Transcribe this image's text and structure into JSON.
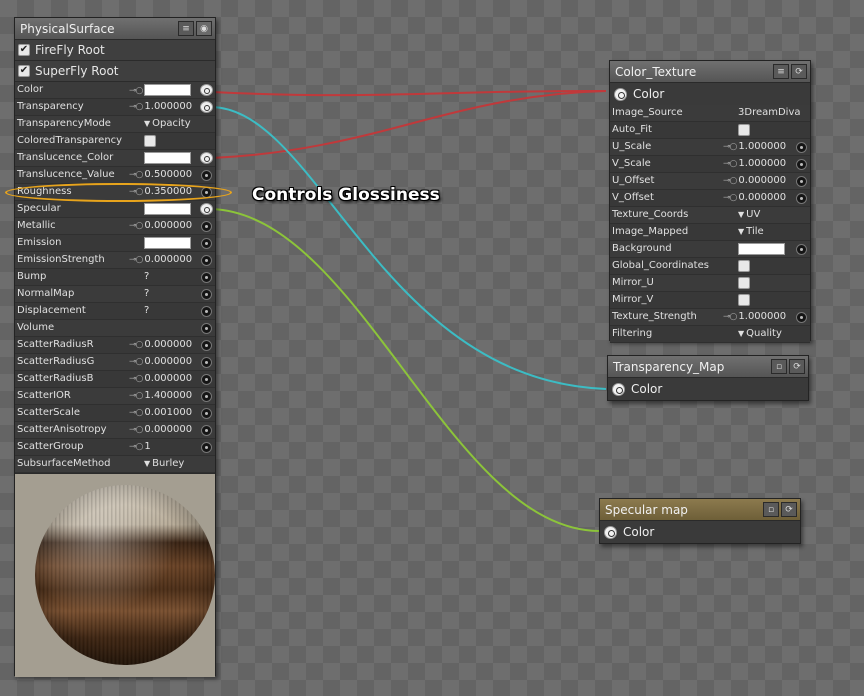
{
  "physical_surface": {
    "title": "PhysicalSurface",
    "roots": [
      {
        "label": "FireFly Root",
        "checked": true
      },
      {
        "label": "SuperFly Root",
        "checked": true
      }
    ],
    "params": [
      {
        "label": "Color",
        "type": "color",
        "value": "",
        "key": true,
        "socket": "linked"
      },
      {
        "label": "Transparency",
        "type": "value",
        "value": "1.000000",
        "key": true,
        "socket": "linked"
      },
      {
        "label": "TransparencyMode",
        "type": "dropdown",
        "value": "Opacity",
        "key": false,
        "socket": "none"
      },
      {
        "label": "ColoredTransparency",
        "type": "checkbox",
        "value": "",
        "key": false,
        "socket": "none"
      },
      {
        "label": "Translucence_Color",
        "type": "color",
        "value": "",
        "key": false,
        "socket": "linked"
      },
      {
        "label": "Translucence_Value",
        "type": "value",
        "value": "0.500000",
        "key": true,
        "socket": "input"
      },
      {
        "label": "Roughness",
        "type": "value",
        "value": "0.350000",
        "key": true,
        "socket": "input"
      },
      {
        "label": "Specular",
        "type": "color",
        "value": "",
        "key": false,
        "socket": "linked"
      },
      {
        "label": "Metallic",
        "type": "value",
        "value": "0.000000",
        "key": true,
        "socket": "input"
      },
      {
        "label": "Emission",
        "type": "color",
        "value": "",
        "key": false,
        "socket": "input"
      },
      {
        "label": "EmissionStrength",
        "type": "value",
        "value": "0.000000",
        "key": true,
        "socket": "input"
      },
      {
        "label": "Bump",
        "type": "text",
        "value": "?",
        "key": false,
        "socket": "input"
      },
      {
        "label": "NormalMap",
        "type": "text",
        "value": "?",
        "key": false,
        "socket": "input"
      },
      {
        "label": "Displacement",
        "type": "text",
        "value": "?",
        "key": false,
        "socket": "input"
      },
      {
        "label": "Volume",
        "type": "none",
        "value": "",
        "key": false,
        "socket": "input"
      },
      {
        "label": "ScatterRadiusR",
        "type": "value",
        "value": "0.000000",
        "key": true,
        "socket": "input"
      },
      {
        "label": "ScatterRadiusG",
        "type": "value",
        "value": "0.000000",
        "key": true,
        "socket": "input"
      },
      {
        "label": "ScatterRadiusB",
        "type": "value",
        "value": "0.000000",
        "key": true,
        "socket": "input"
      },
      {
        "label": "ScatterIOR",
        "type": "value",
        "value": "1.400000",
        "key": true,
        "socket": "input"
      },
      {
        "label": "ScatterScale",
        "type": "value",
        "value": "0.001000",
        "key": true,
        "socket": "input"
      },
      {
        "label": "ScatterAnisotropy",
        "type": "value",
        "value": "0.000000",
        "key": true,
        "socket": "input"
      },
      {
        "label": "ScatterGroup",
        "type": "value",
        "value": "1",
        "key": true,
        "socket": "input"
      },
      {
        "label": "SubsurfaceMethod",
        "type": "dropdown",
        "value": "Burley",
        "key": false,
        "socket": "none"
      }
    ]
  },
  "color_texture": {
    "title": "Color_Texture",
    "output": "Color",
    "params": [
      {
        "label": "Image_Source",
        "type": "text",
        "value": "3DreamDiva",
        "key": false,
        "socket": "none"
      },
      {
        "label": "Auto_Fit",
        "type": "checkbox",
        "value": "",
        "key": false,
        "socket": "none"
      },
      {
        "label": "U_Scale",
        "type": "value",
        "value": "1.000000",
        "key": true,
        "socket": "input"
      },
      {
        "label": "V_Scale",
        "type": "value",
        "value": "1.000000",
        "key": true,
        "socket": "input"
      },
      {
        "label": "U_Offset",
        "type": "value",
        "value": "0.000000",
        "key": true,
        "socket": "input"
      },
      {
        "label": "V_Offset",
        "type": "value",
        "value": "0.000000",
        "key": true,
        "socket": "input"
      },
      {
        "label": "Texture_Coords",
        "type": "dropdown",
        "value": "UV",
        "key": false,
        "socket": "none"
      },
      {
        "label": "Image_Mapped",
        "type": "dropdown",
        "value": "Tile",
        "key": false,
        "socket": "none"
      },
      {
        "label": "Background",
        "type": "color",
        "value": "",
        "key": false,
        "socket": "input"
      },
      {
        "label": "Global_Coordinates",
        "type": "checkbox",
        "value": "",
        "key": false,
        "socket": "none"
      },
      {
        "label": "Mirror_U",
        "type": "checkbox",
        "value": "",
        "key": false,
        "socket": "none"
      },
      {
        "label": "Mirror_V",
        "type": "checkbox",
        "value": "",
        "key": false,
        "socket": "none"
      },
      {
        "label": "Texture_Strength",
        "type": "value",
        "value": "1.000000",
        "key": true,
        "socket": "input"
      },
      {
        "label": "Filtering",
        "type": "dropdown",
        "value": "Quality",
        "key": false,
        "socket": "none"
      }
    ]
  },
  "transparency_map": {
    "title": "Transparency_Map",
    "output": "Color"
  },
  "specular_map": {
    "title": "Specular map",
    "output": "Color"
  },
  "annotation": {
    "text": "Controls Glossiness",
    "color": "#e8a41c"
  },
  "wire_colors": {
    "color": "#c0393b",
    "transparency": "#3cbcc4",
    "specular": "#8cc43a"
  }
}
